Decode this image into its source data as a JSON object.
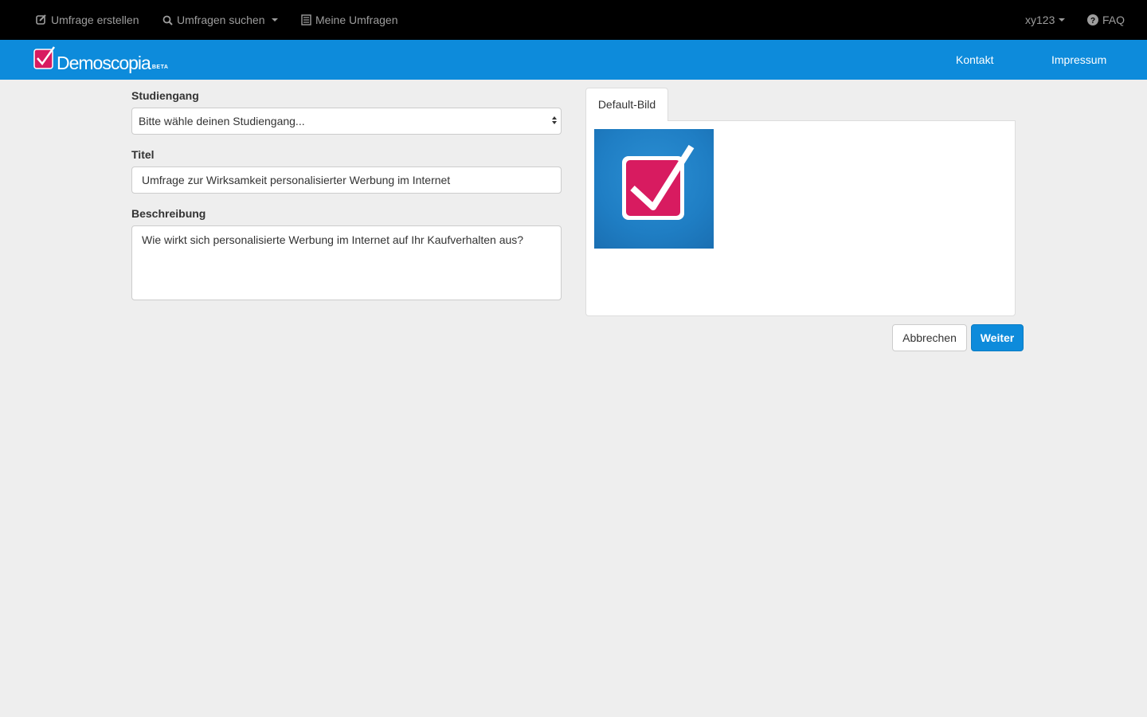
{
  "topnav": {
    "create_survey": "Umfrage erstellen",
    "search_surveys": "Umfragen suchen",
    "my_surveys": "Meine Umfragen",
    "user": "xy123",
    "faq": "FAQ"
  },
  "brand": {
    "name": "Demoscopia",
    "badge": "BETA",
    "links": {
      "contact": "Kontakt",
      "imprint": "Impressum"
    },
    "color": "#0d8bdb",
    "logo_accent": "#d81b60"
  },
  "form": {
    "course": {
      "label": "Studiengang",
      "selected": "Bitte wähle deinen Studiengang..."
    },
    "title": {
      "label": "Titel",
      "value": "Umfrage zur Wirksamkeit personalisierter Werbung im Internet"
    },
    "description": {
      "label": "Beschreibung",
      "value": "Wie wirkt sich personalisierte Werbung im Internet auf Ihr Kaufverhalten aus?"
    }
  },
  "image_panel": {
    "tab_label": "Default-Bild"
  },
  "buttons": {
    "cancel": "Abbrechen",
    "next": "Weiter"
  }
}
